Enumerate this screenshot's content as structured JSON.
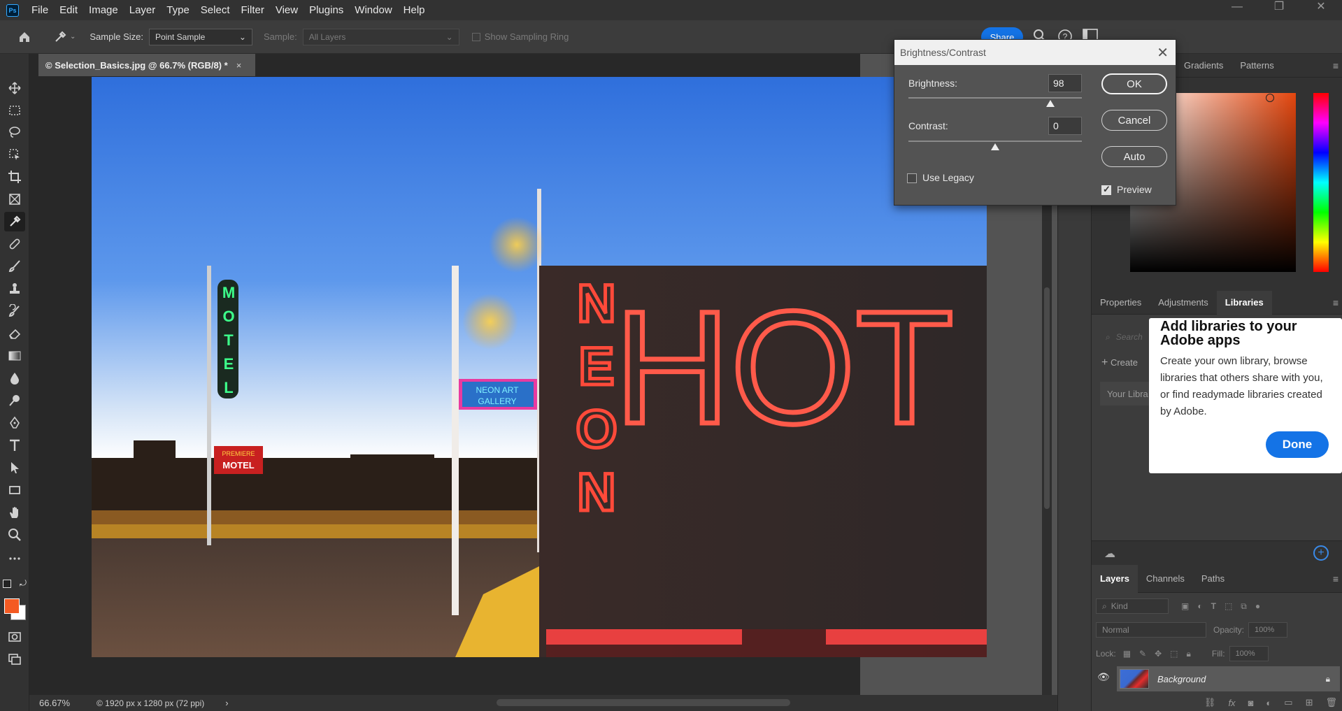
{
  "app": {
    "logo_text": "Ps"
  },
  "menu": [
    "File",
    "Edit",
    "Image",
    "Layer",
    "Type",
    "Select",
    "Filter",
    "View",
    "Plugins",
    "Window",
    "Help"
  ],
  "window_controls": {
    "minimize": "—",
    "restore": "❐",
    "close": "✕"
  },
  "options_bar": {
    "sample_size_label": "Sample Size:",
    "sample_size_value": "Point Sample",
    "sample_label": "Sample:",
    "sample_value": "All Layers",
    "sampling_ring_label": "Show Sampling Ring",
    "share_label": "Share"
  },
  "document": {
    "tab_title": "© Selection_Basics.jpg @ 66.7% (RGB/8) *",
    "close": "×"
  },
  "canvas_signs": {
    "neon": [
      "N",
      "E",
      "O",
      "N"
    ],
    "hot": "HOT",
    "motel": [
      "M",
      "O",
      "T",
      "E",
      "L"
    ],
    "premiere": "PREMIERE",
    "motel2": "MOTEL",
    "gallery1": "NEON ART",
    "gallery2": "GALLERY"
  },
  "status": {
    "zoom": "66.67%",
    "info": "© 1920 px x 1280 px (72 ppi)",
    "arrow": "›"
  },
  "dialog": {
    "title": "Brightness/Contrast",
    "brightness_label": "Brightness:",
    "brightness_value": "98",
    "contrast_label": "Contrast:",
    "contrast_value": "0",
    "ok_label": "OK",
    "cancel_label": "Cancel",
    "auto_label": "Auto",
    "use_legacy_label": "Use Legacy",
    "preview_label": "Preview"
  },
  "color_panel": {
    "tabs": [
      "Gradients",
      "Patterns"
    ]
  },
  "libraries_panel": {
    "tabs": [
      "Properties",
      "Adjustments",
      "Libraries"
    ],
    "search_placeholder": "Search",
    "create_label": "Create",
    "your_libraries": "Your Libra"
  },
  "tooltip": {
    "title": "Add libraries to your Adobe apps",
    "body": "Create your own library, browse libraries that others share with you, or find readymade libraries created by Adobe.",
    "done_label": "Done"
  },
  "layers_panel": {
    "tabs": [
      "Layers",
      "Channels",
      "Paths"
    ],
    "kind_label": "Kind",
    "blend_mode": "Normal",
    "opacity_label": "Opacity:",
    "opacity_value": "100%",
    "lock_label": "Lock:",
    "fill_label": "Fill:",
    "fill_value": "100%",
    "layer_name": "Background"
  },
  "colors": {
    "accent": "#1473e6",
    "foreground_swatch": "#f45a22",
    "background_swatch": "#ffffff"
  }
}
